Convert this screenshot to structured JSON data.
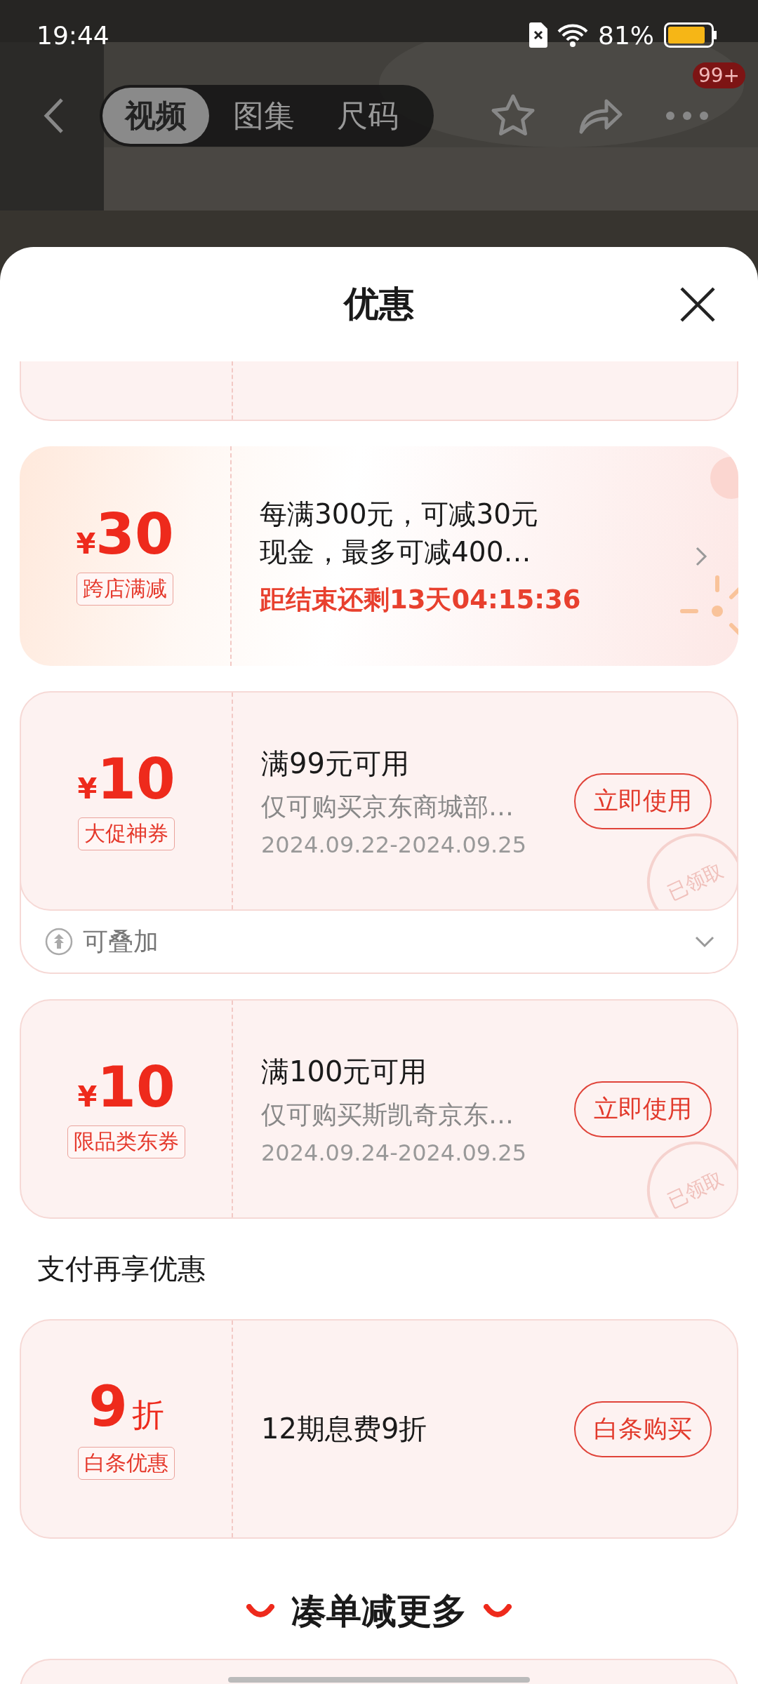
{
  "status_bar": {
    "time": "19:44",
    "battery": "81%"
  },
  "nav": {
    "tabs": [
      {
        "label": "视频",
        "selected": true
      },
      {
        "label": "图集",
        "selected": false
      },
      {
        "label": "尺码",
        "selected": false
      }
    ],
    "badge": "99+"
  },
  "sheet": {
    "title": "优惠"
  },
  "offers": [
    {
      "kind": "promo",
      "currency": "¥",
      "amount": "30",
      "tag": "跨店满减",
      "lines": [
        "每满300元，可减30元",
        "现金，最多可减400…"
      ],
      "countdown": "距结束还剩13天04:15:36"
    },
    {
      "kind": "coupon",
      "currency": "¥",
      "amount": "10",
      "tag": "大促神券",
      "title": "满99元可用",
      "desc": "仅可购买京东商城部…",
      "dates": "2024.09.22-2024.09.25",
      "button": "立即使用",
      "stamp": "已领取",
      "stack_label": "可叠加",
      "expanded": false
    },
    {
      "kind": "coupon",
      "currency": "¥",
      "amount": "10",
      "tag": "限品类东券",
      "title": "满100元可用",
      "desc": "仅可购买斯凯奇京东…",
      "dates": "2024.09.24-2024.09.25",
      "button": "立即使用",
      "stamp": "已领取"
    }
  ],
  "payment": {
    "heading": "支付再享优惠",
    "offers": [
      {
        "kind": "discount",
        "amount": "9",
        "unit": "折",
        "tag": "白条优惠",
        "title": "12期息费9折",
        "button": "白条购买"
      }
    ]
  },
  "more": {
    "title": "凑单减更多"
  }
}
